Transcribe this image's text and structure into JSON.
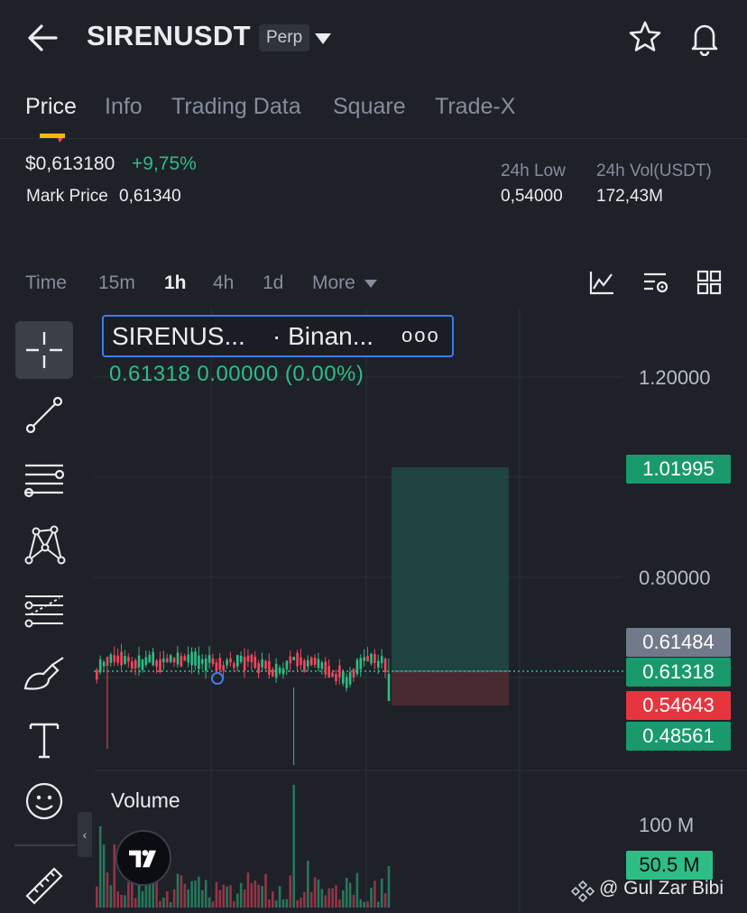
{
  "header": {
    "symbol": "SIRENUSDT",
    "contract_type": "Perp"
  },
  "tabs": [
    "Price",
    "Info",
    "Trading Data",
    "Square",
    "Trade-X"
  ],
  "price": {
    "last": "$0,613180",
    "change": "+9,75%",
    "mark_label": "Mark Price",
    "mark_value": "0,61340"
  },
  "stats": {
    "low_label": "24h Low",
    "low_value": "0,54000",
    "vol_label": "24h Vol(USDT)",
    "vol_value": "172,43M"
  },
  "intervals": {
    "items": [
      "Time",
      "15m",
      "1h",
      "4h",
      "1d",
      "More"
    ],
    "active": "1h"
  },
  "chart": {
    "legend_name": "SIRENUS...",
    "legend_exchange": "· Binan...",
    "legend_more": "ooo",
    "legend_values": "0.61318  0.00000 (0.00%)",
    "axis_labels": [
      "1.20000",
      "0.80000"
    ],
    "price_tags": {
      "take_profit": "1.01995",
      "high": "0.61484",
      "last": "0.61318",
      "entry": "0.54643",
      "low": "0.48561"
    },
    "volume_label": "Volume",
    "volume_axis": "100 M",
    "volume_tag": "50.5 M"
  },
  "colors": {
    "up": "#2ebd85",
    "down": "#f6465d",
    "accent": "#f0b90b",
    "background": "#1e2128"
  },
  "watermark": "@ Gul Zar Bibi"
}
